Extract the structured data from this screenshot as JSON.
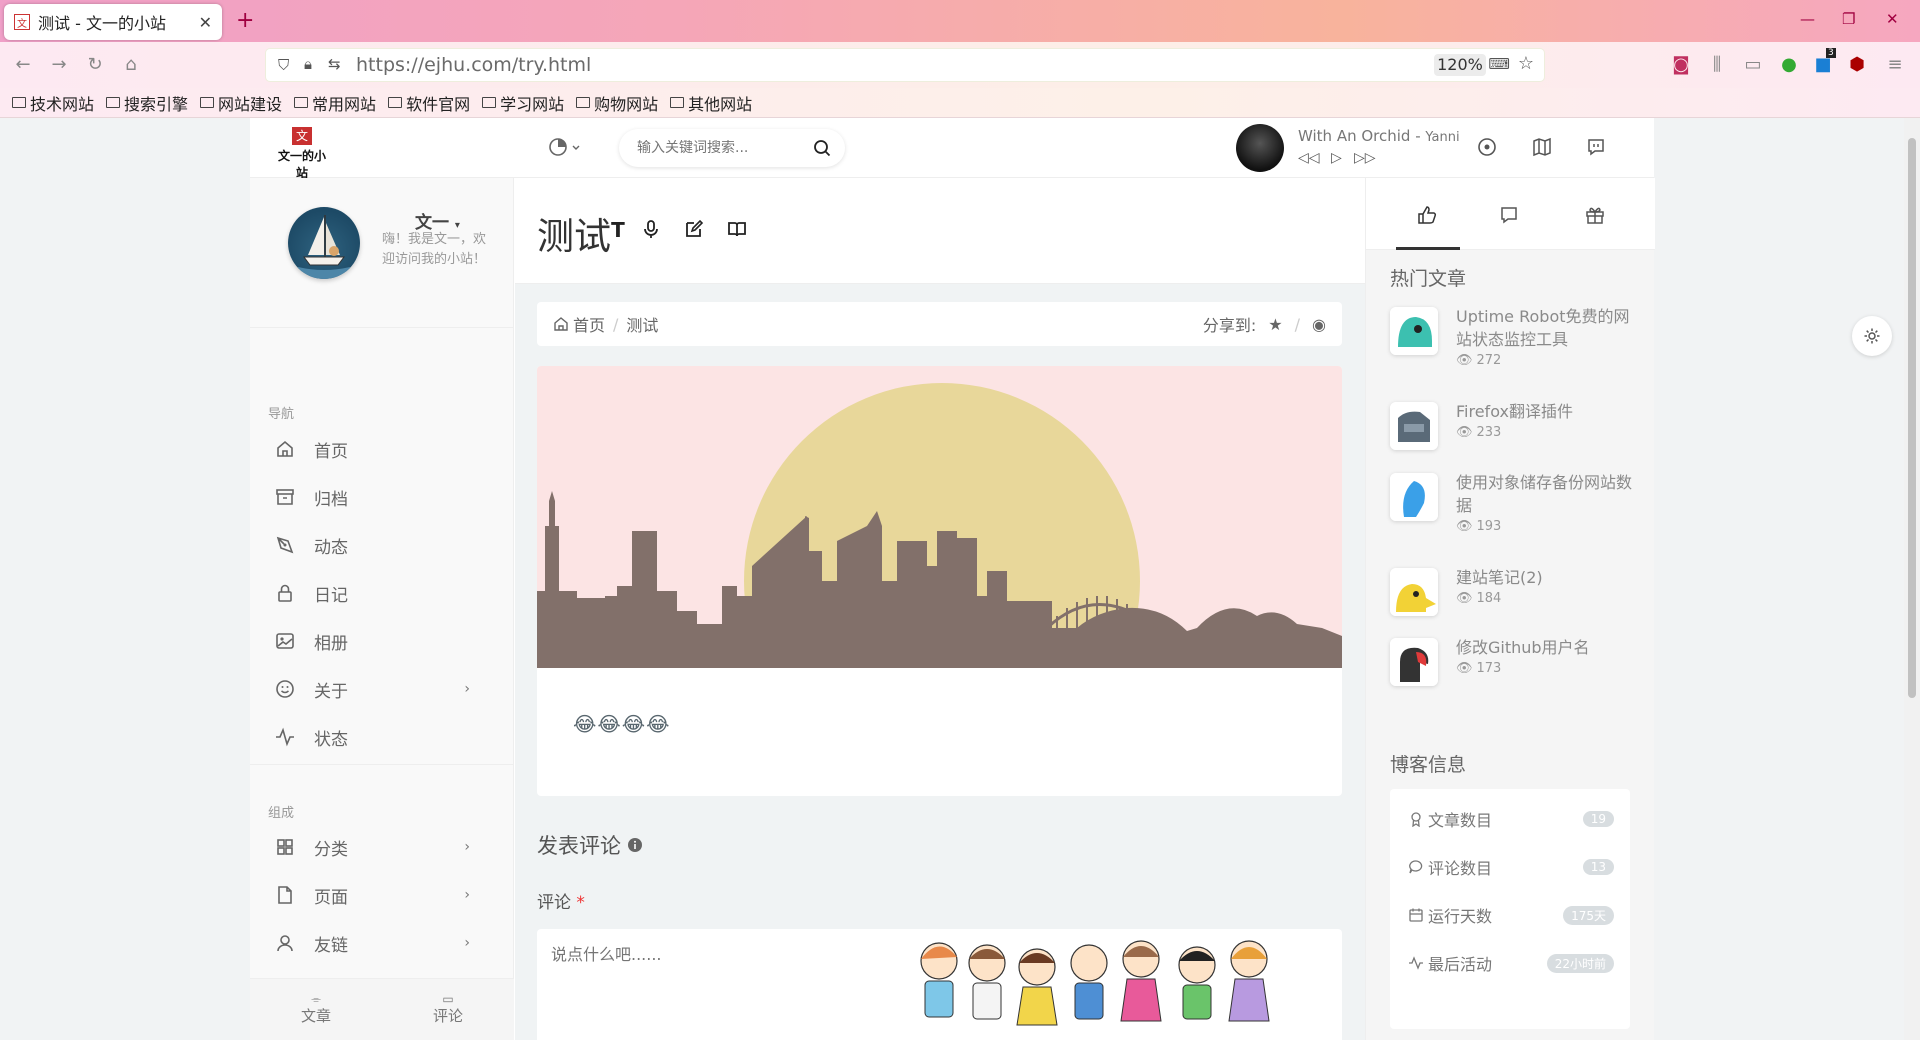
{
  "browser": {
    "tab_title": "测试 - 文一的小站",
    "tab_favicon": "文",
    "new_tab": "+",
    "url": "https://ejhu.com/try.html",
    "zoom": "120%",
    "bookmarks": [
      "技术网站",
      "搜索引擎",
      "网站建设",
      "常用网站",
      "软件官网",
      "学习网站",
      "购物网站",
      "其他网站"
    ],
    "ext_badge": "3"
  },
  "header": {
    "logo_mark": "文",
    "logo_text": "文一的小站",
    "search_placeholder": "输入关键词搜索...",
    "player_song": "With An Orchid",
    "player_sep": " - ",
    "player_artist": "Yanni"
  },
  "sidebar": {
    "username": "文一",
    "bio": "嗨！我是文一，欢迎访问我的小站！",
    "nav_label": "导航",
    "nav": [
      {
        "label": "首页",
        "icon": "home-icon"
      },
      {
        "label": "归档",
        "icon": "archive-icon"
      },
      {
        "label": "动态",
        "icon": "pen-icon"
      },
      {
        "label": "日记",
        "icon": "lock-icon"
      },
      {
        "label": "相册",
        "icon": "image-icon"
      },
      {
        "label": "关于",
        "icon": "smile-icon",
        "submenu": true
      },
      {
        "label": "状态",
        "icon": "activity-icon"
      }
    ],
    "group_label": "组成",
    "group": [
      {
        "label": "分类",
        "icon": "grid-icon",
        "submenu": true
      },
      {
        "label": "页面",
        "icon": "file-icon",
        "submenu": true
      },
      {
        "label": "友链",
        "icon": "user-icon",
        "submenu": true
      }
    ],
    "footer_tabs": [
      "文章",
      "评论"
    ]
  },
  "main": {
    "title": "测试",
    "breadcrumb_home": "首页",
    "breadcrumb_sep": "/",
    "breadcrumb_current": "测试",
    "share_label": "分享到:",
    "share_sep": "/",
    "body_emoji": "😂😂😂😂",
    "comment_header": "发表评论",
    "comment_label": "评论",
    "comment_required": "*",
    "comment_placeholder": "说点什么吧......"
  },
  "rightbar": {
    "hot_title": "热门文章",
    "posts": [
      {
        "title": "Uptime Robot免费的网站状态监控工具",
        "views": "272"
      },
      {
        "title": "Firefox翻译插件",
        "views": "233"
      },
      {
        "title": "使用对象储存备份网站数据",
        "views": "193"
      },
      {
        "title": "建站笔记(2)",
        "views": "184"
      },
      {
        "title": "修改Github用户名",
        "views": "173"
      }
    ],
    "info_title": "博客信息",
    "stats": [
      {
        "label": "文章数目",
        "value": "19"
      },
      {
        "label": "评论数目",
        "value": "13"
      },
      {
        "label": "运行天数",
        "value": "175天"
      },
      {
        "label": "最后活动",
        "value": "22小时前"
      }
    ]
  },
  "colors": {
    "banner_bg": "#fce4e4",
    "banner_sun": "#e8d79a",
    "banner_city": "#82706a"
  }
}
